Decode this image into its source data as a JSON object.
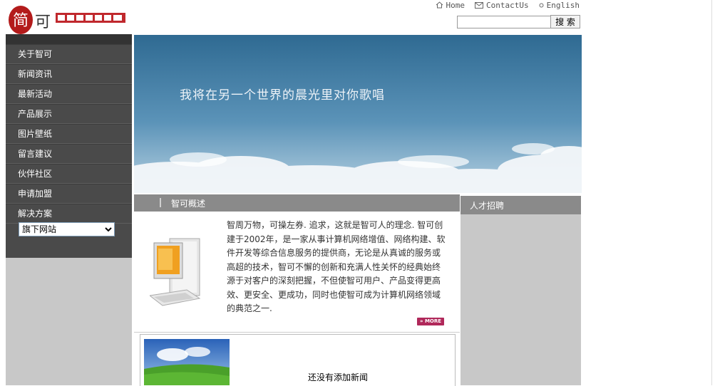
{
  "header": {
    "links": [
      {
        "icon": "home-icon",
        "label": "Home"
      },
      {
        "icon": "mail-icon",
        "label": "ContactUs"
      },
      {
        "icon": "bullet-icon",
        "label": "English"
      }
    ],
    "search": {
      "value": "",
      "button_label": "搜 索"
    }
  },
  "sidebar": {
    "items": [
      "关于智可",
      "新闻资讯",
      "最新活动",
      "产品展示",
      "图片壁纸",
      "留言建议",
      "伙伴社区",
      "申请加盟",
      "解决方案"
    ],
    "select_value": "旗下网站"
  },
  "banner": {
    "text": "我将在另一个世界的晨光里对你歌唱"
  },
  "overview": {
    "title": "智可概述",
    "body": "智周万物，可操左券. 追求，这就是智可人的理念. 智可创建于2002年，是一家从事计算机网络增值、网络构建、软件开发等综合信息服务的提供商，无论是从真诚的服务或高超的技术，智可不懈的创新和充满人性关怀的经典始终源于对客户的深刻把握，不但使智可用户、产品变得更高效、更安全、更成功，同时也使智可成为计算机网络领域的典范之一.",
    "more_label": "MORE"
  },
  "recruit": {
    "title": "人才招聘"
  },
  "news": {
    "empty_text": "还没有添加新闻"
  },
  "colors": {
    "sidebar": "#4a4a4a",
    "bar": "#8a8a8a",
    "accent": "#b0285a",
    "panel": "#c8c8c8"
  }
}
